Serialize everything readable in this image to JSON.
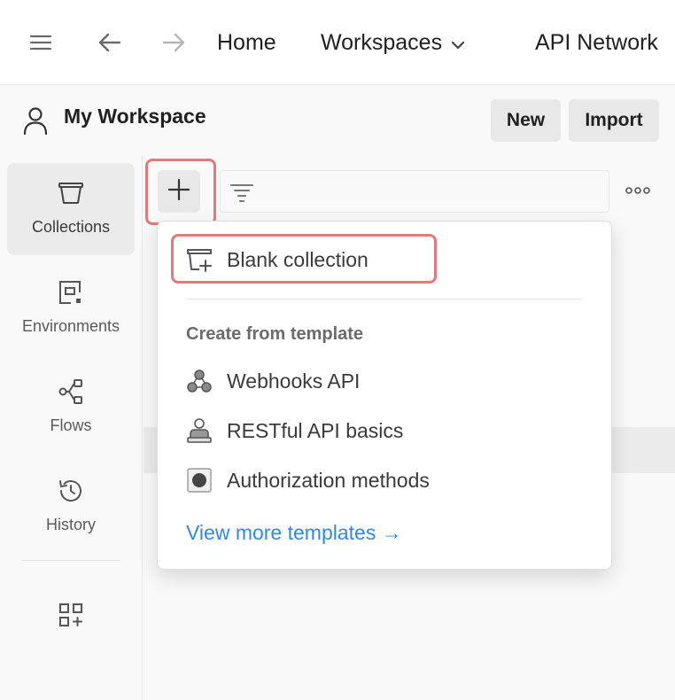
{
  "topbar": {
    "menu_icon": "hamburger-icon",
    "back_icon": "arrow-left-icon",
    "forward_icon": "arrow-right-icon",
    "nav": [
      {
        "label": "Home"
      },
      {
        "label": "Workspaces",
        "icon": "chevron-down-icon"
      },
      {
        "label": "API Network"
      }
    ]
  },
  "workspace": {
    "icon": "user-icon",
    "name": "My Workspace",
    "new_label": "New",
    "import_label": "Import"
  },
  "sidebar": {
    "items": [
      {
        "label": "Collections",
        "icon": "collection-icon",
        "active": true
      },
      {
        "label": "Environments",
        "icon": "environment-icon"
      },
      {
        "label": "Flows",
        "icon": "flows-icon"
      },
      {
        "label": "History",
        "icon": "history-icon"
      }
    ],
    "extra_icon": "add-widget-icon"
  },
  "toolbar": {
    "add_icon": "plus-icon",
    "filter_icon": "filter-icon",
    "more_icon": "more-horizontal-icon"
  },
  "dropdown": {
    "blank_label": "Blank collection",
    "blank_icon": "new-collection-icon",
    "heading": "Create from template",
    "templates": [
      {
        "label": "Webhooks API",
        "icon": "webhooks-icon"
      },
      {
        "label": "RESTful API basics",
        "icon": "restful-icon"
      },
      {
        "label": "Authorization methods",
        "icon": "authorization-icon"
      }
    ],
    "view_more": "View more templates →"
  },
  "colors": {
    "highlight": "#e07b7b",
    "link": "#2f8ae6",
    "button_bg": "#e8e8e8"
  }
}
